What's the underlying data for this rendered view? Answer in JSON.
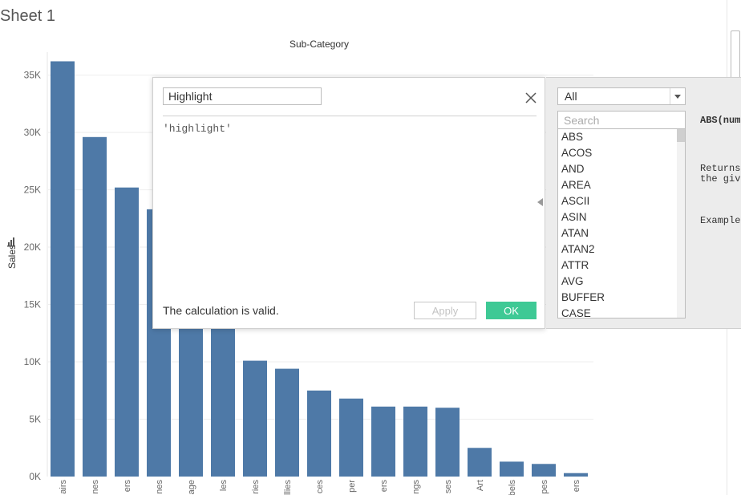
{
  "sheet": {
    "title": "Sheet 1"
  },
  "chart_data": {
    "type": "bar",
    "title": "Sub-Category",
    "xlabel": "",
    "ylabel": "Sales",
    "ylim": [
      0,
      37000
    ],
    "yticks": [
      0,
      5000,
      10000,
      15000,
      20000,
      25000,
      30000,
      35000
    ],
    "ytick_labels": [
      "0K",
      "5K",
      "10K",
      "15K",
      "20K",
      "25K",
      "30K",
      "35K"
    ],
    "categories": [
      "airs",
      "nes",
      "ers",
      "nes",
      "age",
      "les",
      "ries",
      "llies",
      "ces",
      "per",
      "ers",
      "ngs",
      "ses",
      "Art",
      "bels",
      "pes",
      "ers"
    ],
    "values": [
      36200,
      29600,
      25200,
      23300,
      20400,
      19800,
      10100,
      9400,
      7500,
      6800,
      6100,
      6100,
      6000,
      2500,
      1300,
      1100,
      300
    ],
    "bar_color": "#4e79a7",
    "grid": true
  },
  "dialog": {
    "name_value": "Highlight",
    "formula": "'highlight'",
    "status": "The calculation is valid.",
    "apply_label": "Apply",
    "ok_label": "OK",
    "close_icon": "close-icon",
    "ok_color": "#3ec995"
  },
  "function_panel": {
    "category_value": "All",
    "search_placeholder": "Search",
    "functions": [
      "ABS",
      "ACOS",
      "AND",
      "AREA",
      "ASCII",
      "ASIN",
      "ATAN",
      "ATAN2",
      "ATTR",
      "AVG",
      "BUFFER",
      "CASE"
    ],
    "help_title": "ABS(num",
    "help_desc_1": "Returns",
    "help_desc_2": "the giv",
    "help_example": "Example"
  }
}
